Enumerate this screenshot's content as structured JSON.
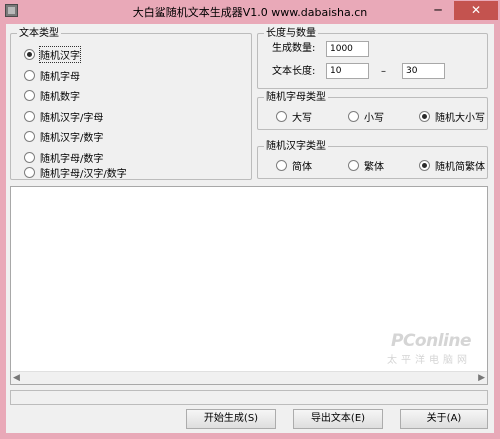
{
  "window": {
    "title": "大白鲨随机文本生成器V1.0 www.dabaisha.cn",
    "minimize_glyph": "─",
    "close_glyph": "✕"
  },
  "text_type": {
    "label": "文本类型",
    "options": [
      "随机汉字",
      "随机字母",
      "随机数字",
      "随机汉字/字母",
      "随机汉字/数字",
      "随机字母/数字",
      "随机字母/汉字/数字"
    ],
    "selected": 0
  },
  "length_count": {
    "label": "长度与数量",
    "count_label": "生成数量:",
    "count_value": "1000",
    "length_label": "文本长度:",
    "length_min": "10",
    "dash": "–",
    "length_max": "30"
  },
  "letter_type": {
    "label": "随机字母类型",
    "options": [
      "大写",
      "小写",
      "随机大小写"
    ],
    "selected": 2
  },
  "hanzi_type": {
    "label": "随机汉字类型",
    "options": [
      "简体",
      "繁体",
      "随机简繁体"
    ],
    "selected": 2
  },
  "output": {
    "value": ""
  },
  "watermark": {
    "main": "PConline",
    "sub": "太平洋电脑网"
  },
  "buttons": {
    "start": "开始生成(S)",
    "export": "导出文本(E)",
    "about": "关于(A)"
  },
  "scroll_glyphs": {
    "left": "◀",
    "right": "▶"
  }
}
